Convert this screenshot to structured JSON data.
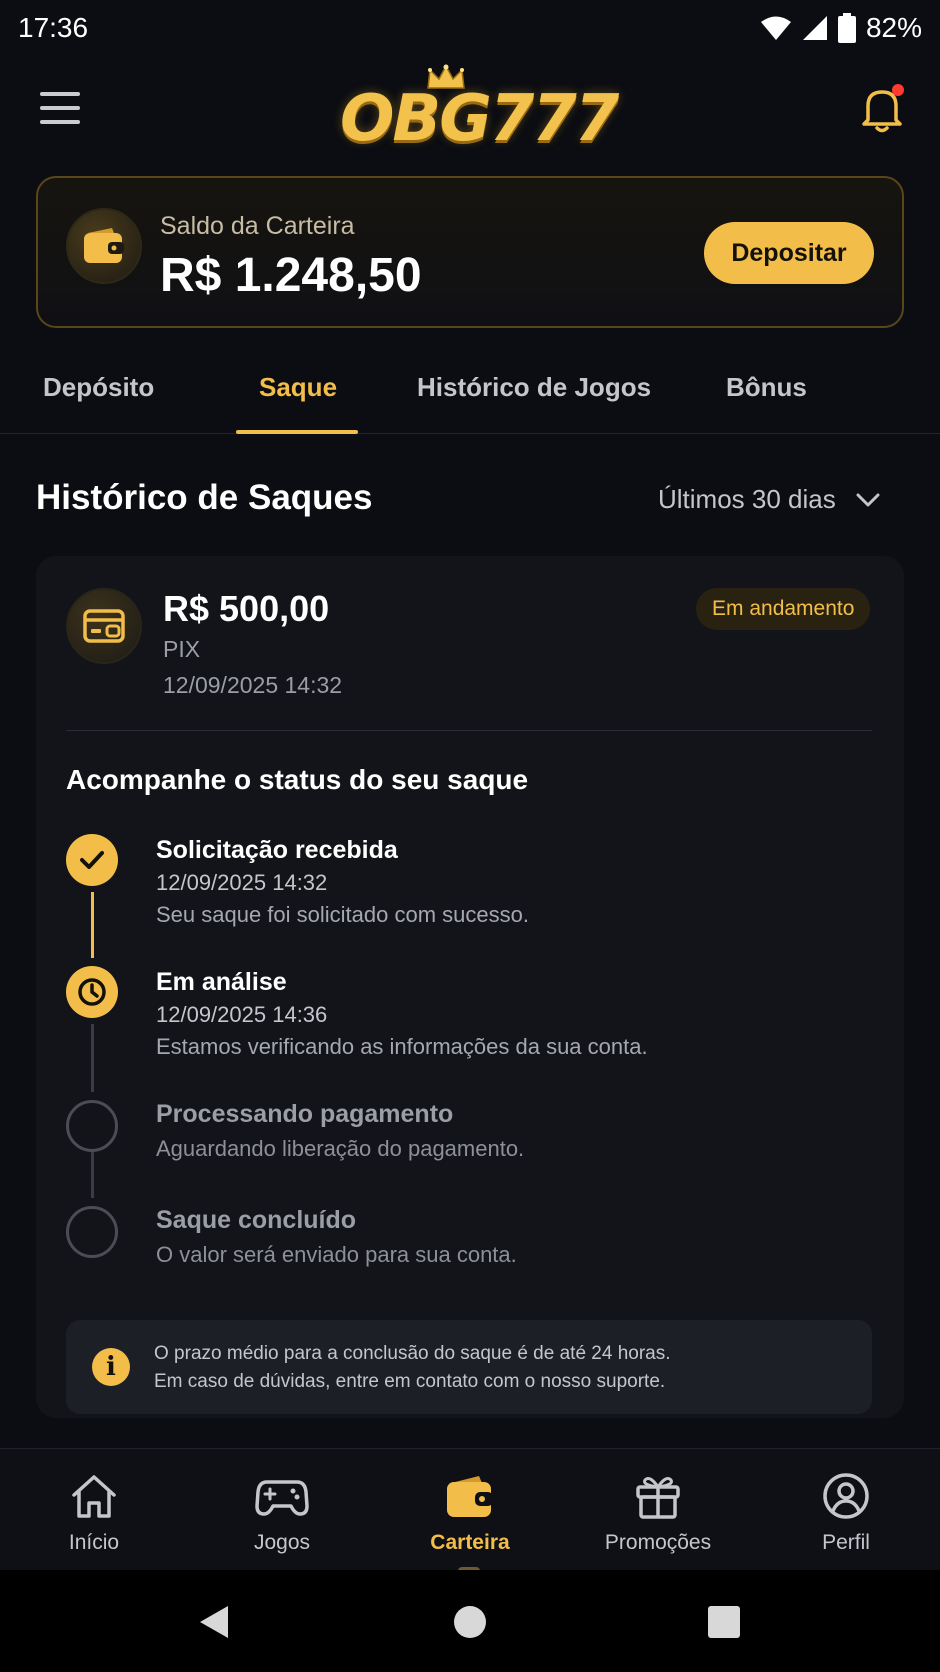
{
  "status_bar": {
    "time": "17:36",
    "battery": "82%"
  },
  "header": {
    "logo": "OBG777",
    "notification_dot": true
  },
  "wallet": {
    "label": "Saldo da Carteira",
    "balance": "R$ 1.248,50",
    "deposit_label": "Depositar"
  },
  "tabs": [
    {
      "label": "Depósito",
      "active": false
    },
    {
      "label": "Saque",
      "active": true
    },
    {
      "label": "Histórico de Jogos",
      "active": false
    },
    {
      "label": "Bônus",
      "active": false
    }
  ],
  "section": {
    "title": "Histórico de Saques",
    "filter": "Últimos 30 dias"
  },
  "transaction": {
    "amount": "R$ 500,00",
    "method": "PIX",
    "date": "12/09/2025 14:32",
    "status": "Em andamento"
  },
  "tracking": {
    "title": "Acompanhe o status do seu saque",
    "steps": [
      {
        "title": "Solicitação recebida",
        "date": "12/09/2025 14:32",
        "text": "Seu saque foi solicitado com sucesso.",
        "state": "done",
        "icon": "check-icon"
      },
      {
        "title": "Em análise",
        "date": "12/09/2025 14:36",
        "text": "Estamos verificando as informações da sua conta.",
        "state": "current",
        "icon": "clock-icon"
      },
      {
        "title": "Processando pagamento",
        "text": "Aguardando liberação do pagamento.",
        "state": "pending"
      },
      {
        "title": "Saque concluído",
        "text": "O valor será enviado para sua conta.",
        "state": "pending"
      }
    ]
  },
  "info": {
    "line1": "O prazo médio para a conclusão do saque é de até 24 horas.",
    "line2": "Em caso de dúvidas, entre em contato com o nosso suporte."
  },
  "bottom_nav": [
    {
      "label": "Início",
      "icon": "home-icon",
      "active": false
    },
    {
      "label": "Jogos",
      "icon": "gamepad-icon",
      "active": false
    },
    {
      "label": "Carteira",
      "icon": "wallet-icon",
      "active": true
    },
    {
      "label": "Promoções",
      "icon": "gift-icon",
      "active": false
    },
    {
      "label": "Perfil",
      "icon": "user-icon",
      "active": false
    }
  ],
  "colors": {
    "accent": "#f2be49",
    "background": "#0b0d12",
    "card": "#12141a"
  }
}
